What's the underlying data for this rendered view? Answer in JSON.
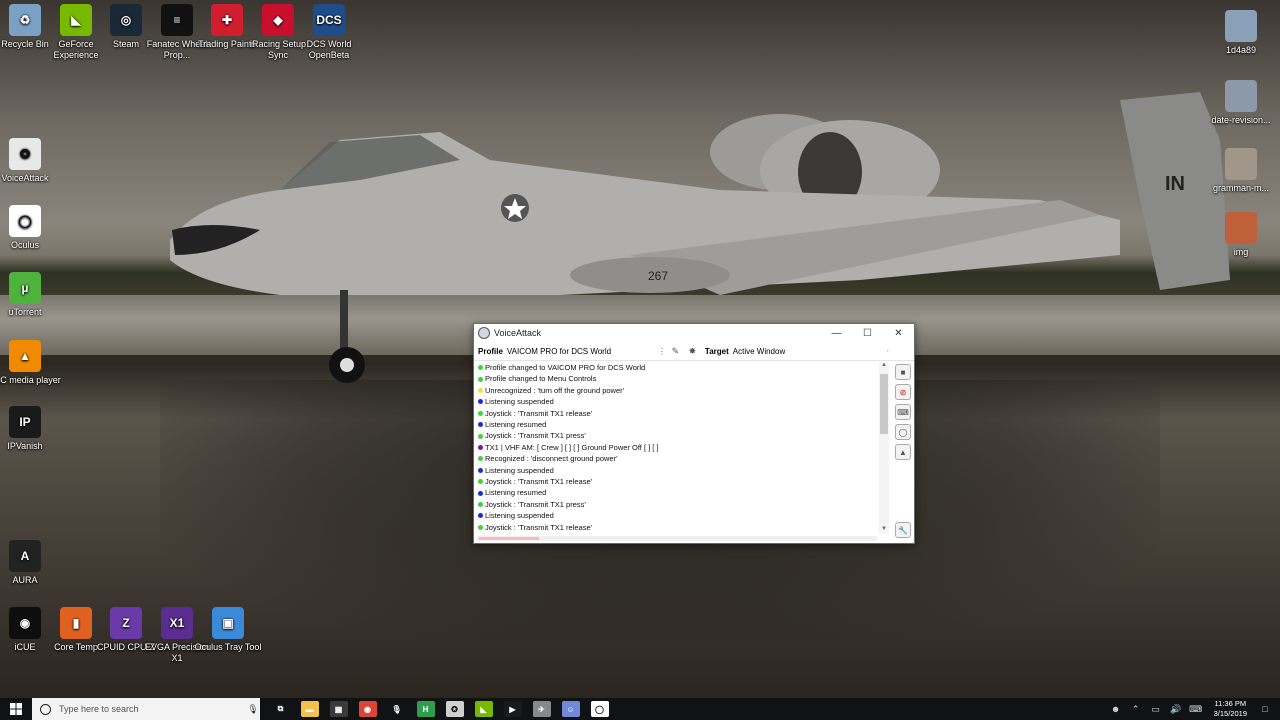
{
  "desktop": {
    "left_column": [
      {
        "label": "Recycle Bin",
        "color": "#7aa0c4",
        "glyph": "♻"
      },
      {
        "label": "VoiceAttack",
        "color": "#e8e8e8",
        "glyph": "✪"
      },
      {
        "label": "Oculus",
        "color": "#ffffff",
        "glyph": "◯"
      },
      {
        "label": "uTorrent",
        "color": "#4db33d",
        "glyph": "µ"
      },
      {
        "label": "VLC media player",
        "color": "#f08a00",
        "glyph": "▲"
      },
      {
        "label": "IPVanish",
        "color": "#1a1a1a",
        "glyph": "IP"
      },
      {
        "label": "AURA",
        "color": "#222222",
        "glyph": "A"
      },
      {
        "label": "iCUE",
        "color": "#0e0e0e",
        "glyph": "◉"
      }
    ],
    "top_row": [
      {
        "label": "GeForce Experience",
        "color": "#76b900",
        "glyph": "◣"
      },
      {
        "label": "Steam",
        "color": "#1b2838",
        "glyph": "◎"
      },
      {
        "label": "Fanatec Wheel Prop...",
        "color": "#111111",
        "glyph": "≡"
      },
      {
        "label": "Trading Paints",
        "color": "#d01e2f",
        "glyph": "✚"
      },
      {
        "label": "iRacing Setup Sync",
        "color": "#c8102e",
        "glyph": "◆"
      },
      {
        "label": "DCS World OpenBeta",
        "color": "#1f4d8c",
        "glyph": "DCS"
      }
    ],
    "bottom_row": [
      {
        "label": "Core Temp",
        "color": "#e06020",
        "glyph": "▮"
      },
      {
        "label": "CPUID CPU-Z",
        "color": "#6a3aa8",
        "glyph": "Z"
      },
      {
        "label": "EVGA Precision X1",
        "color": "#5a2d91",
        "glyph": "X1"
      },
      {
        "label": "Oculus Tray Tool",
        "color": "#3a8ad8",
        "glyph": "▣"
      }
    ],
    "right_column": [
      {
        "label": "1d4a89",
        "color": "#8aa0b8"
      },
      {
        "label": "date-revision...",
        "color": "#8b99a8"
      },
      {
        "label": "gramman-m...",
        "color": "#a0968a"
      },
      {
        "label": "img",
        "color": "#c0603a"
      }
    ]
  },
  "voiceattack": {
    "title": "VoiceAttack",
    "profile_label": "Profile",
    "profile_value": "VAICOM PRO for DCS World",
    "target_label": "Target",
    "target_value": "Active Window",
    "log": [
      {
        "text": "Profile changed to VAICOM PRO for DCS World",
        "color": "#3bd43b"
      },
      {
        "text": "Profile changed to Menu Controls",
        "color": "#3bd43b"
      },
      {
        "text": "Unrecognized : 'turn off the ground power'",
        "color": "#f0e040"
      },
      {
        "text": "Listening suspended",
        "color": "#1a2cd8"
      },
      {
        "text": "Joystick : 'Transmit TX1 release'",
        "color": "#3bd43b"
      },
      {
        "text": "Listening resumed",
        "color": "#1a2cd8"
      },
      {
        "text": "Joystick : 'Transmit TX1 press'",
        "color": "#3bd43b"
      },
      {
        "text": "TX1 | VHF AM: [ Crew ] [   ] [   ] Ground Power Off [   ] [   ]",
        "color": "#7a1a9a"
      },
      {
        "text": "Recognized : 'disconnect ground power'",
        "color": "#3bd43b"
      },
      {
        "text": "Listening suspended",
        "color": "#1a2cd8"
      },
      {
        "text": "Joystick : 'Transmit TX1 release'",
        "color": "#3bd43b"
      },
      {
        "text": "Listening resumed",
        "color": "#1a2cd8"
      },
      {
        "text": "Joystick : 'Transmit TX1 press'",
        "color": "#3bd43b"
      },
      {
        "text": "Listening suspended",
        "color": "#1a2cd8"
      },
      {
        "text": "Joystick : 'Transmit TX1 release'",
        "color": "#3bd43b"
      }
    ]
  },
  "taskbar": {
    "search_placeholder": "Type here to search",
    "pinned": [
      {
        "name": "task-view-icon",
        "color": "#101214",
        "glyph": "⧉"
      },
      {
        "name": "file-explorer-icon",
        "color": "#f2c14e",
        "glyph": "▬"
      },
      {
        "name": "calculator-icon",
        "color": "#3a3a3a",
        "glyph": "▦"
      },
      {
        "name": "chrome-icon",
        "color": "#db4437",
        "glyph": "◉"
      },
      {
        "name": "microphone-app-icon",
        "color": "#101214",
        "glyph": "🎙"
      },
      {
        "name": "h-app-icon",
        "color": "#2e9e4e",
        "glyph": "H"
      },
      {
        "name": "voiceattack-task-icon",
        "color": "#d0d0d0",
        "glyph": "✪"
      },
      {
        "name": "nvidia-icon",
        "color": "#76b900",
        "glyph": "◣"
      },
      {
        "name": "terminal-icon",
        "color": "#1a1a1a",
        "glyph": "▶"
      },
      {
        "name": "fighter-jet-icon",
        "color": "#888888",
        "glyph": "✈"
      },
      {
        "name": "discord-icon",
        "color": "#7289da",
        "glyph": "☺"
      },
      {
        "name": "oculus-task-icon",
        "color": "#ffffff",
        "glyph": "◯"
      }
    ],
    "clock_time": "11:36 PM",
    "clock_date": "3/15/2019"
  }
}
